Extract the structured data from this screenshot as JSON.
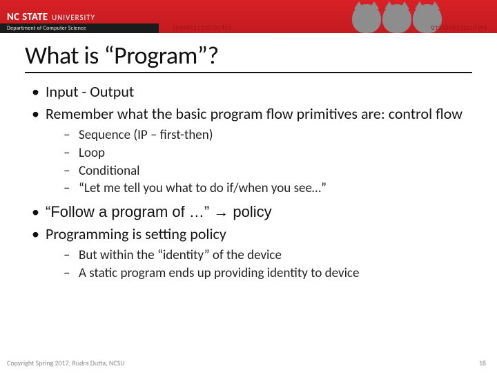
{
  "header": {
    "logo_main": "NC STATE",
    "logo_univ": "UNIVERSITY",
    "dept": "Department of Computer Science",
    "binary1": "10100111110101101",
    "binary2": "0101010101010101"
  },
  "title": "What is “Program”?",
  "bullets": [
    {
      "text": "Input - Output"
    },
    {
      "text": "Remember what the basic program flow primitives are: control flow",
      "sub": [
        "Sequence (IP – first-then)",
        "Loop",
        "Conditional",
        "“Let me tell you what to do if/when you see…”"
      ]
    },
    {
      "text": "“Follow a program of …” → policy"
    },
    {
      "text": "Programming is setting policy",
      "sub": [
        "But within the “identity” of the device",
        "A static program ends up providing identity to device"
      ]
    }
  ],
  "footer": {
    "copyright": "Copyright Spring 2017, Rudra Dutta, NCSU",
    "page": "18"
  }
}
